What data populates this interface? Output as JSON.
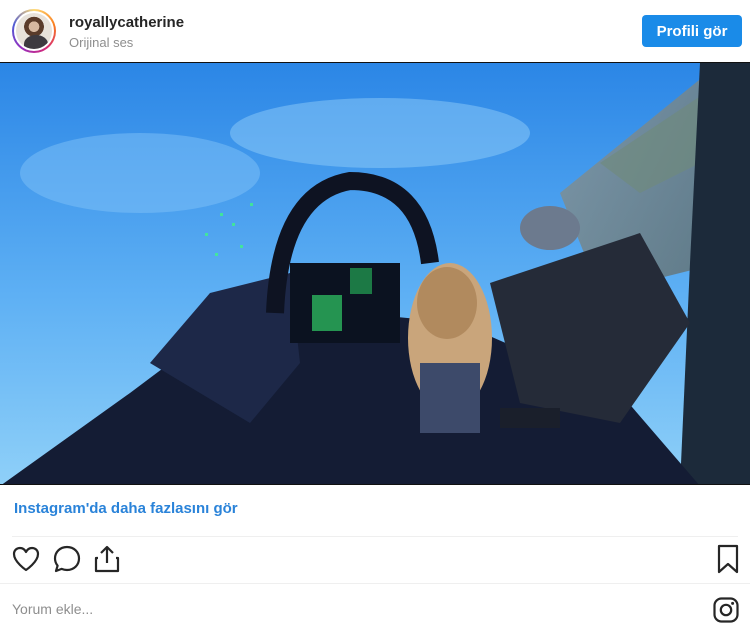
{
  "header": {
    "username": "royallycatherine",
    "subtitle": "Orijinal ses",
    "profile_button": "Profili gör"
  },
  "media": {
    "description_icon": "video-still"
  },
  "footer": {
    "more_link": "Instagram'da daha fazlasını gör",
    "comment_placeholder": "Yorum ekle...",
    "icons": [
      "heart-icon",
      "comment-icon",
      "share-icon",
      "bookmark-icon",
      "instagram-icon"
    ]
  },
  "colors": {
    "accent": "#1a8be8",
    "link": "#2a83d9",
    "muted": "#8e8e8e"
  }
}
